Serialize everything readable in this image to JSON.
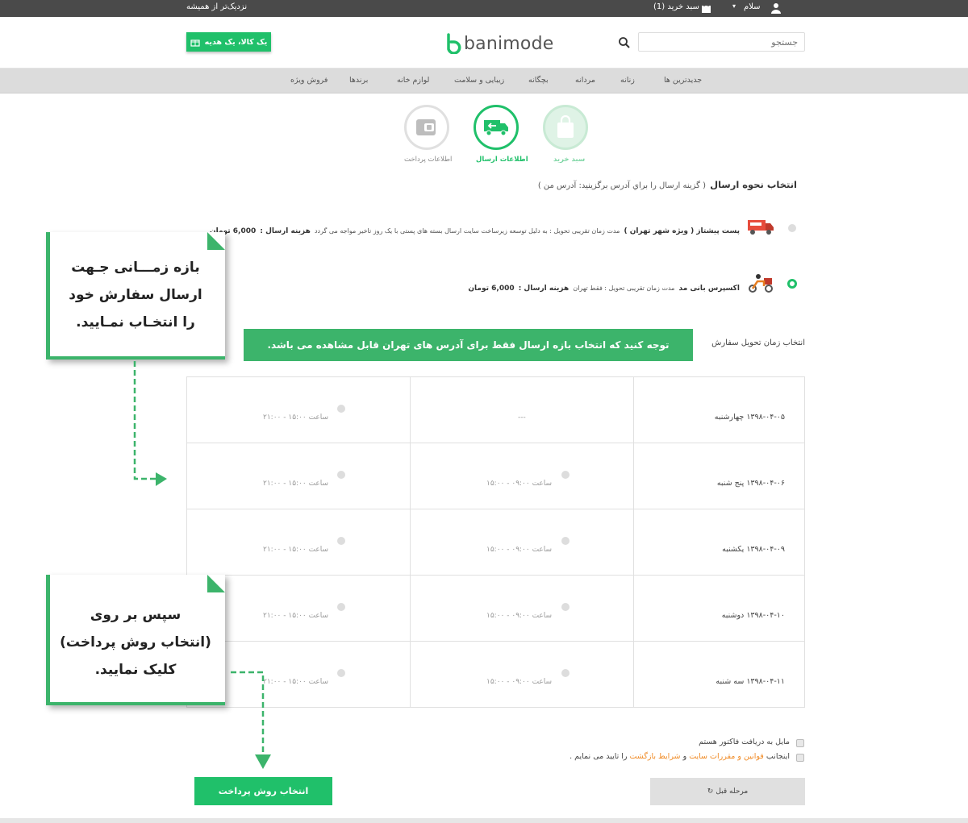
{
  "topbar": {
    "user_greeting": "سلام",
    "cart_label": "سبد خرید (1)",
    "slogan": "نزدیک‌تر از همیشه"
  },
  "header": {
    "search_placeholder": "جستجو",
    "logo_text": "banimode",
    "gift_button": "یک کالا، یک هدیه"
  },
  "nav": {
    "items": [
      "جدیدترین ها",
      "زنانه",
      "مردانه",
      "بچگانه",
      "زیبایی و سلامت",
      "لوازم خانه",
      "برندها",
      "فروش ویژه"
    ]
  },
  "steps": [
    {
      "label": "سبد خرید",
      "icon": "shopping-bag-icon"
    },
    {
      "label": "اطلاعات ارسال",
      "icon": "delivery-truck-icon"
    },
    {
      "label": "اطلاعات پرداخت",
      "icon": "wallet-icon"
    }
  ],
  "shipping": {
    "heading": "انتخاب نحوه ارسال",
    "subheading": "( گزینه ارسال را براي آدرس برگزينيد: آدرس من )",
    "options": [
      {
        "name": "پست پیشتاز ( ویژه شهر تهران )",
        "desc": "مدت زمان تقریبی تحویل : به دلیل توسعه زیرساخت سایت ارسال بسته های پستی با یک روز تاخیر مواجه می گردد",
        "cost_label": "هزینه ارسال :",
        "cost": "6,000 تومان",
        "selected": false
      },
      {
        "name": "اکسپرس بانی مد",
        "desc": "مدت زمان تقریبی تحویل : فقط تهران",
        "cost_label": "هزینه ارسال :",
        "cost": "6,000 تومان",
        "selected": true
      }
    ]
  },
  "delivery": {
    "label": "انتخاب زمان تحویل سفارش",
    "notice": "توجه کنید که انتخاب بازه ارسال فقط برای آدرس های تهران قابل مشاهده می باشد.",
    "rows": [
      {
        "date": "۱۳۹۸-۰۴-۰۵ چهارشنبه",
        "slot1": "---",
        "slot2": "ساعت ۱۵:۰۰ - ۲۱:۰۰"
      },
      {
        "date": "۱۳۹۸-۰۴-۰۶ پنج شنبه",
        "slot1": "ساعت ۰۹:۰۰ - ۱۵:۰۰",
        "slot2": "ساعت ۱۵:۰۰ - ۲۱:۰۰"
      },
      {
        "date": "۱۳۹۸-۰۴-۰۹ یکشنبه",
        "slot1": "ساعت ۰۹:۰۰ - ۱۵:۰۰",
        "slot2": "ساعت ۱۵:۰۰ - ۲۱:۰۰"
      },
      {
        "date": "۱۳۹۸-۰۴-۱۰ دوشنبه",
        "slot1": "ساعت ۰۹:۰۰ - ۱۵:۰۰",
        "slot2": "ساعت ۱۵:۰۰ - ۲۱:۰۰"
      },
      {
        "date": "۱۳۹۸-۰۴-۱۱ سه شنبه",
        "slot1": "ساعت ۰۹:۰۰ - ۱۵:۰۰",
        "slot2": "ساعت ۱۵:۰۰ - ۲۱:۰۰"
      }
    ]
  },
  "agreements": {
    "invoice": "مایل به دریافت فاکتور هستم",
    "terms_prefix": "اینجانب",
    "terms_link1": "قوانین و مقررات سایت",
    "terms_and": "و",
    "terms_link2": "شرایط بازگشت",
    "terms_suffix": "را تایید می نمایم ."
  },
  "buttons": {
    "pay": "انتخاب روش پرداخت",
    "prev": "مرحله قبل"
  },
  "callouts": {
    "first": [
      "بازه زمـــانی جـهت",
      "ارسال سفارش خود",
      "را انتخـاب نمـایید."
    ],
    "second": [
      "سپس بر روی",
      "(انتخاب روش پرداخت)",
      "کلیک نمایید."
    ]
  },
  "colors": {
    "accent": "#20c06a",
    "callout_green": "#3cb46b",
    "link_orange": "#f08a24"
  }
}
